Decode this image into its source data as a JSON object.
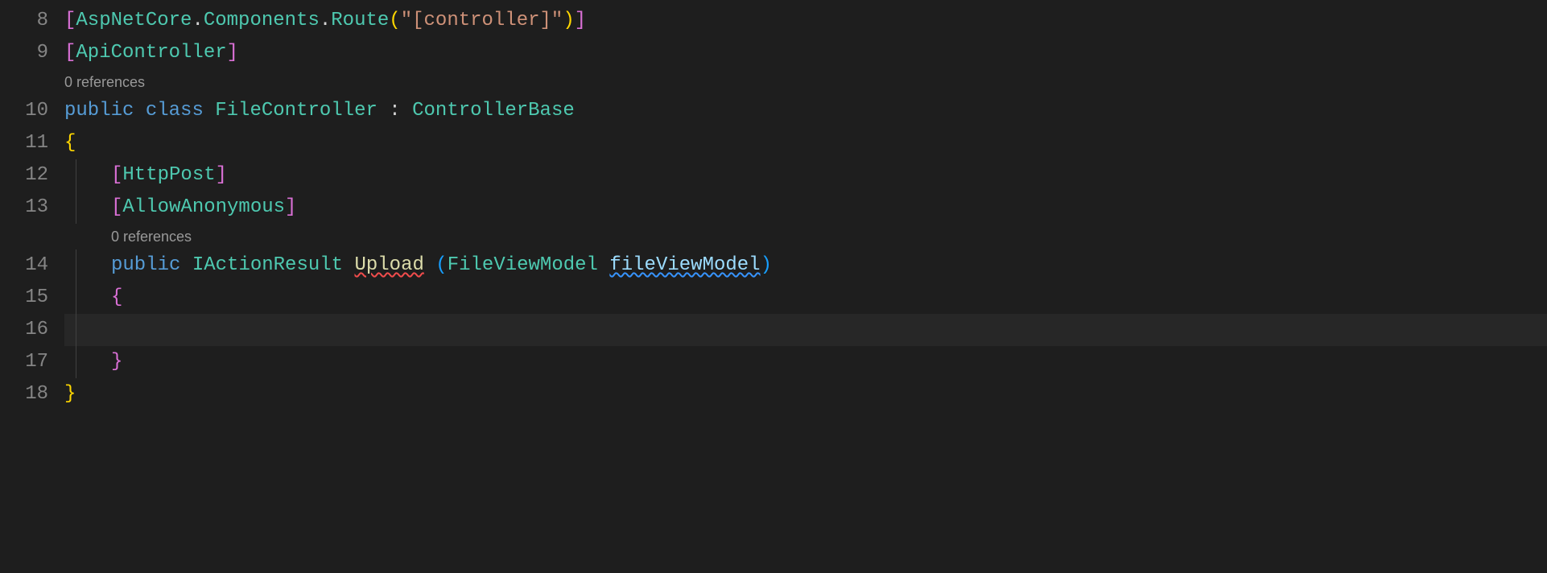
{
  "lineNumbers": [
    "8",
    "9",
    "10",
    "11",
    "12",
    "13",
    "14",
    "15",
    "16",
    "17",
    "18"
  ],
  "codelens": {
    "classRefs": "0 references",
    "methodRefs": "0 references"
  },
  "line8": {
    "lbracket": "[",
    "ns1": "AspNetCore",
    "dot1": ".",
    "ns2": "Components",
    "dot2": ".",
    "attr": "Route",
    "lparen": "(",
    "string": "\"[controller]\"",
    "rparen": ")",
    "rbracket": "]"
  },
  "line9": {
    "lbracket": "[",
    "attr": "ApiController",
    "rbracket": "]"
  },
  "line10": {
    "kw_public": "public",
    "kw_class": "class",
    "name": "FileController",
    "colon": ":",
    "base": "ControllerBase"
  },
  "line11": {
    "brace": "{"
  },
  "line12": {
    "lbracket": "[",
    "attr": "HttpPost",
    "rbracket": "]"
  },
  "line13": {
    "lbracket": "[",
    "attr": "AllowAnonymous",
    "rbracket": "]"
  },
  "line14": {
    "kw_public": "public",
    "ret": "IActionResult",
    "name": "Upload",
    "lparen": "(",
    "ptype": "FileViewModel",
    "pname": "fileViewModel",
    "rparen": ")"
  },
  "line15": {
    "brace": "{"
  },
  "line17": {
    "brace": "}"
  },
  "line18": {
    "brace": "}"
  }
}
